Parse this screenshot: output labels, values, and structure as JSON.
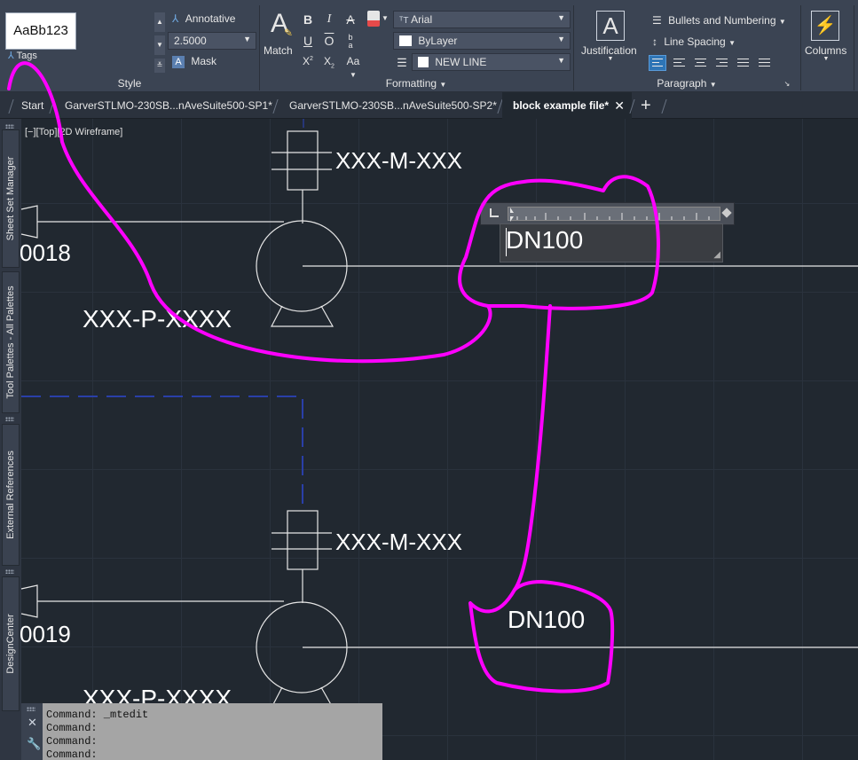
{
  "ribbon": {
    "style_panel": {
      "title": "Style",
      "preview_text": "AaBb123",
      "preview_label": "Tags",
      "annotative": "Annotative",
      "text_height": "2.5000",
      "mask": "Mask"
    },
    "formatting_panel": {
      "title": "Formatting",
      "match": "Match",
      "font": "Arial",
      "color": "ByLayer",
      "layer": "NEW LINE",
      "case": "Aa"
    },
    "paragraph_panel": {
      "title": "Paragraph",
      "justification": "Justification",
      "bullets": "Bullets and Numbering",
      "line_spacing": "Line Spacing"
    },
    "columns": "Columns"
  },
  "tabs": [
    {
      "label": "Start"
    },
    {
      "label": "GarverSTLMO-230SB...nAveSuite500-SP1*"
    },
    {
      "label": "GarverSTLMO-230SB...nAveSuite500-SP2*"
    },
    {
      "label": "block example file*"
    }
  ],
  "palettes": [
    "Sheet Set Manager",
    "Tool Palettes - All Palettes",
    "External References",
    "DesignCenter"
  ],
  "viewport_label": "[−][Top][2D Wireframe]",
  "drawing": {
    "top_tag_motor": "XXX-M-XXX",
    "top_tag_pump": "XXX-P-XXXX",
    "top_number": "0018",
    "top_dn": "DN100",
    "bottom_tag_motor": "XXX-M-XXX",
    "bottom_tag_pump": "XXX-P-XXXX",
    "bottom_number": "0019",
    "bottom_dn": "DN100"
  },
  "command_lines": [
    "Command: _mtedit",
    "Command:",
    "Command:",
    "Command:"
  ],
  "colors": {
    "annotation": "#ff00ff",
    "ribbon": "#3b4453",
    "canvas": "#212830",
    "active_button": "#2e75b6"
  }
}
